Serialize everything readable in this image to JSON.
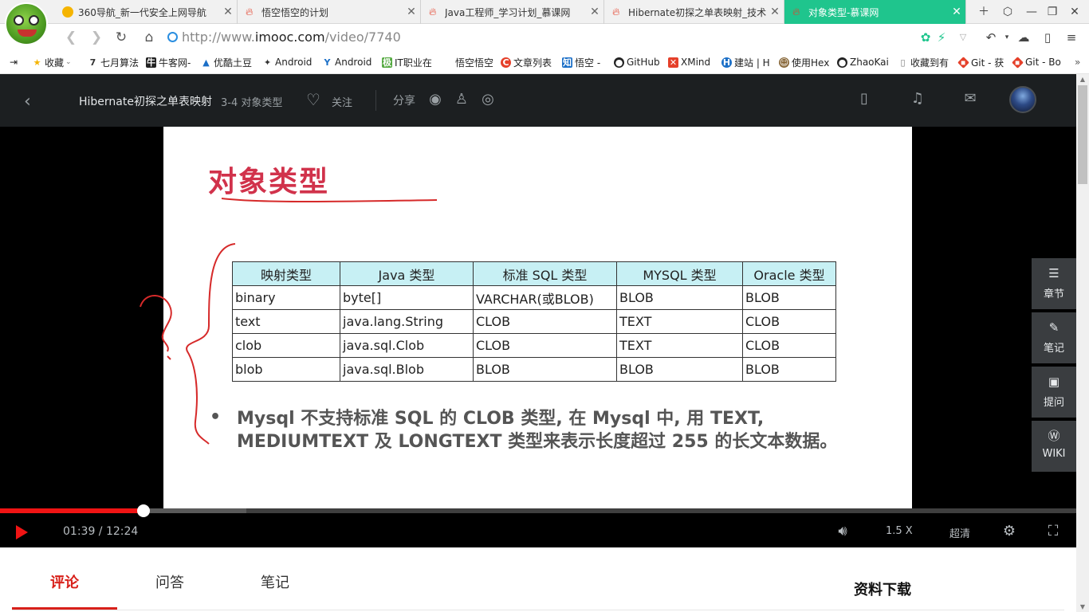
{
  "browser": {
    "tabs": [
      {
        "label": "360导航_新一代安全上网导航",
        "icon": "360-icon",
        "color": "#f5b400"
      },
      {
        "label": "悟空悟空的计划",
        "icon": "flame-icon",
        "color": "#e5402a"
      },
      {
        "label": "Java工程师_学习计划_慕课网",
        "icon": "flame-icon",
        "color": "#e5402a"
      },
      {
        "label": "Hibernate初探之单表映射_技术学",
        "icon": "flame-icon",
        "color": "#e5402a"
      },
      {
        "label": "对象类型-慕课网",
        "icon": "flame-icon",
        "color": "#e5402a"
      }
    ],
    "address": {
      "scheme": "http://www.",
      "host": "imooc.com",
      "path": "/video/7740"
    },
    "bookmarks": [
      {
        "label": "收藏",
        "icon": "star-icon"
      },
      {
        "label": "七月算法",
        "icon": "seven-icon"
      },
      {
        "label": "牛客网-",
        "icon": "nowcoder-icon"
      },
      {
        "label": "优酷土豆",
        "icon": "youku-icon"
      },
      {
        "label": "Android",
        "icon": "android-icon"
      },
      {
        "label": "Android",
        "icon": "android-y-icon"
      },
      {
        "label": "IT职业在",
        "icon": "ji-icon"
      },
      {
        "label": "悟空悟空",
        "icon": "flame-icon"
      },
      {
        "label": "文章列表",
        "icon": "csdn-icon"
      },
      {
        "label": "悟空 -",
        "icon": "zhihu-icon"
      },
      {
        "label": "GitHub",
        "icon": "github-icon"
      },
      {
        "label": "XMind",
        "icon": "xmind-icon"
      },
      {
        "label": "建站 | H",
        "icon": "h-icon"
      },
      {
        "label": "使用Hex",
        "icon": "hexo-icon"
      },
      {
        "label": "ZhaoKai",
        "icon": "github-icon"
      },
      {
        "label": "收藏到有",
        "icon": "page-icon"
      },
      {
        "label": "Git - 获",
        "icon": "git-icon"
      },
      {
        "label": "Git - Bo",
        "icon": "git-icon"
      }
    ]
  },
  "header": {
    "course_title": "Hibernate初探之单表映射",
    "chapter": "3-4 对象类型",
    "follow_label": "关注",
    "share_label": "分享"
  },
  "slide": {
    "title": "对象类型",
    "table": {
      "headers": [
        "映射类型",
        "Java 类型",
        "标准 SQL 类型",
        "MYSQL 类型",
        "Oracle 类型"
      ],
      "rows": [
        [
          "binary",
          "byte[]",
          "VARCHAR(或BLOB)",
          "BLOB",
          "BLOB"
        ],
        [
          "text",
          "java.lang.String",
          "CLOB",
          "TEXT",
          "CLOB"
        ],
        [
          "clob",
          "java.sql.Clob",
          "CLOB",
          "TEXT",
          "CLOB"
        ],
        [
          "blob",
          "java.sql.Blob",
          "BLOB",
          "BLOB",
          "BLOB"
        ]
      ]
    },
    "bullet": "•",
    "note_line1": "Mysql 不支持标准 SQL 的 CLOB 类型, 在 Mysql 中, 用 TEXT,",
    "note_line2": "MEDIUMTEXT 及 LONGTEXT 类型来表示长度超过 255 的长文本数据。"
  },
  "sidebar": [
    {
      "label": "章节",
      "icon": "list-icon"
    },
    {
      "label": "笔记",
      "icon": "pencil-icon"
    },
    {
      "label": "提问",
      "icon": "question-icon"
    },
    {
      "label": "WIKI",
      "icon": "wiki-icon"
    }
  ],
  "player": {
    "current_time": "01:39",
    "duration": "12:24",
    "progress": 0.133,
    "buffered": 0.229,
    "speed": "1.5 X",
    "quality": "超清"
  },
  "lower_tabs": {
    "items": [
      "评论",
      "问答",
      "笔记"
    ],
    "active": 0,
    "download_label": "资料下载"
  },
  "colors": {
    "accent": "#f01414",
    "tab_active": "#1fc58d",
    "slide_title": "#d1324b"
  }
}
